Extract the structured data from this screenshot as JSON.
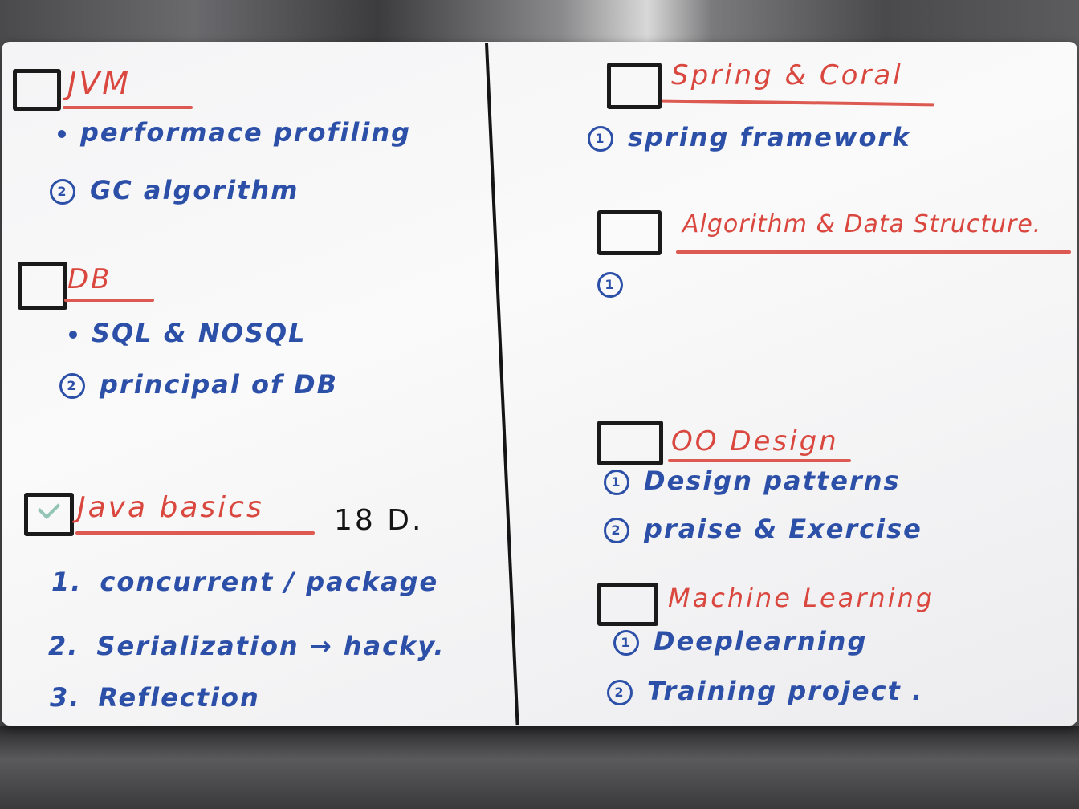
{
  "sections": {
    "jvm": {
      "title": "JVM",
      "items": [
        {
          "marker": "①",
          "text": "performace profiling"
        },
        {
          "marker": "②",
          "text": "GC algorithm"
        }
      ]
    },
    "db": {
      "title": "DB",
      "items": [
        {
          "marker": "①",
          "text": "SQL & NOSQL"
        },
        {
          "marker": "②",
          "text": "principal of DB"
        }
      ]
    },
    "java_basics": {
      "title": "Java basics",
      "note": "18 D.",
      "checked": true,
      "items": [
        {
          "marker": "1.",
          "text": "concurrent / package"
        },
        {
          "marker": "2.",
          "text": "Serialization → hacky."
        },
        {
          "marker": "3.",
          "text": "Reflection"
        }
      ]
    },
    "spring": {
      "title": "Spring & Coral",
      "items": [
        {
          "marker": "①",
          "text": "spring framework"
        }
      ]
    },
    "algorithms": {
      "title": "Algorithm & Data Structure.",
      "items": [
        {
          "marker": "①",
          "text": ""
        }
      ]
    },
    "oo_design": {
      "title": "OO Design",
      "items": [
        {
          "marker": "①",
          "text": "Design patterns"
        },
        {
          "marker": "②",
          "text": "praise & Exercise"
        }
      ]
    },
    "ml": {
      "title": "Machine Learning",
      "items": [
        {
          "marker": "①",
          "text": "Deeplearning"
        },
        {
          "marker": "②",
          "text": "Training project ."
        }
      ]
    }
  },
  "colors": {
    "heading": "#d9473e",
    "item": "#2c4fa8",
    "box": "#1a1a1a",
    "check": "#7ab8a6"
  }
}
